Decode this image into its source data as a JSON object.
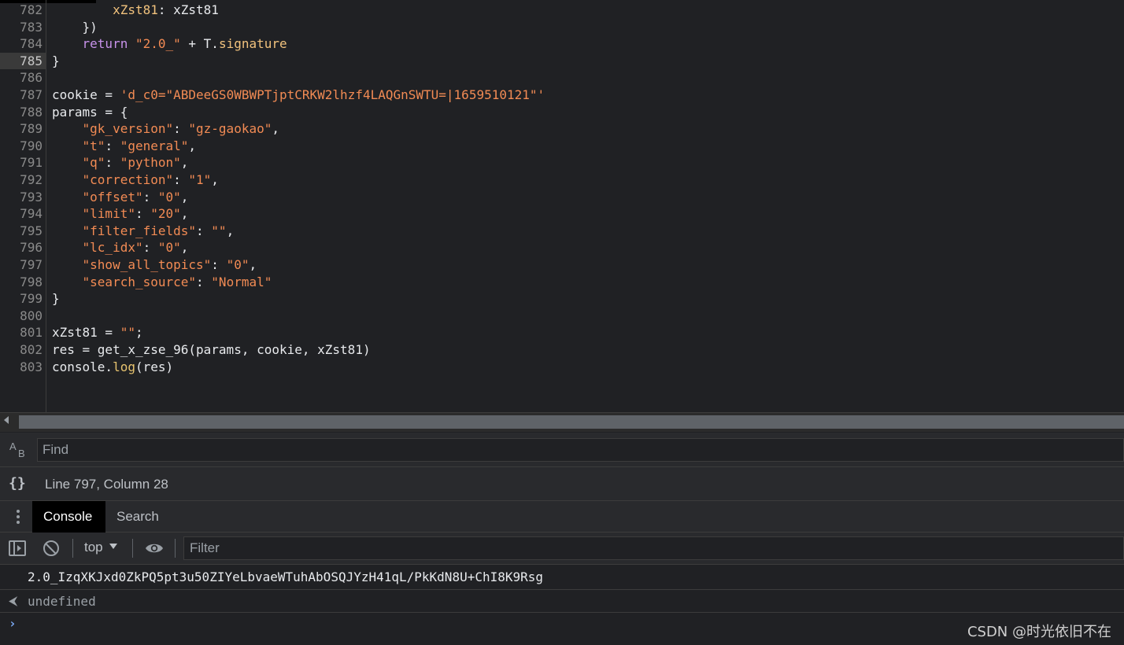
{
  "editor": {
    "active_line": 785,
    "lines": [
      {
        "n": "782",
        "tokens": [
          {
            "t": "        ",
            "c": "plain"
          },
          {
            "t": "xZst81",
            "c": "prop"
          },
          {
            "t": ": xZst81",
            "c": "plain"
          }
        ]
      },
      {
        "n": "783",
        "tokens": [
          {
            "t": "    })",
            "c": "plain"
          }
        ]
      },
      {
        "n": "784",
        "tokens": [
          {
            "t": "    ",
            "c": "plain"
          },
          {
            "t": "return",
            "c": "kw"
          },
          {
            "t": " ",
            "c": "plain"
          },
          {
            "t": "\"2.0_\"",
            "c": "str"
          },
          {
            "t": " + T.",
            "c": "plain"
          },
          {
            "t": "signature",
            "c": "prop"
          }
        ]
      },
      {
        "n": "785",
        "tokens": [
          {
            "t": "}",
            "c": "plain"
          }
        ]
      },
      {
        "n": "786",
        "tokens": []
      },
      {
        "n": "787",
        "tokens": [
          {
            "t": "cookie = ",
            "c": "plain"
          },
          {
            "t": "'d_c0=\"ABDeeGS0WBWPTjptCRKW2lhzf4LAQGnSWTU=|1659510121\"'",
            "c": "str"
          }
        ]
      },
      {
        "n": "788",
        "tokens": [
          {
            "t": "params = {",
            "c": "plain"
          }
        ]
      },
      {
        "n": "789",
        "tokens": [
          {
            "t": "    ",
            "c": "plain"
          },
          {
            "t": "\"gk_version\"",
            "c": "str"
          },
          {
            "t": ": ",
            "c": "plain"
          },
          {
            "t": "\"gz-gaokao\"",
            "c": "str"
          },
          {
            "t": ",",
            "c": "plain"
          }
        ]
      },
      {
        "n": "790",
        "tokens": [
          {
            "t": "    ",
            "c": "plain"
          },
          {
            "t": "\"t\"",
            "c": "str"
          },
          {
            "t": ": ",
            "c": "plain"
          },
          {
            "t": "\"general\"",
            "c": "str"
          },
          {
            "t": ",",
            "c": "plain"
          }
        ]
      },
      {
        "n": "791",
        "tokens": [
          {
            "t": "    ",
            "c": "plain"
          },
          {
            "t": "\"q\"",
            "c": "str"
          },
          {
            "t": ": ",
            "c": "plain"
          },
          {
            "t": "\"python\"",
            "c": "str"
          },
          {
            "t": ",",
            "c": "plain"
          }
        ]
      },
      {
        "n": "792",
        "tokens": [
          {
            "t": "    ",
            "c": "plain"
          },
          {
            "t": "\"correction\"",
            "c": "str"
          },
          {
            "t": ": ",
            "c": "plain"
          },
          {
            "t": "\"1\"",
            "c": "str"
          },
          {
            "t": ",",
            "c": "plain"
          }
        ]
      },
      {
        "n": "793",
        "tokens": [
          {
            "t": "    ",
            "c": "plain"
          },
          {
            "t": "\"offset\"",
            "c": "str"
          },
          {
            "t": ": ",
            "c": "plain"
          },
          {
            "t": "\"0\"",
            "c": "str"
          },
          {
            "t": ",",
            "c": "plain"
          }
        ]
      },
      {
        "n": "794",
        "tokens": [
          {
            "t": "    ",
            "c": "plain"
          },
          {
            "t": "\"limit\"",
            "c": "str"
          },
          {
            "t": ": ",
            "c": "plain"
          },
          {
            "t": "\"20\"",
            "c": "str"
          },
          {
            "t": ",",
            "c": "plain"
          }
        ]
      },
      {
        "n": "795",
        "tokens": [
          {
            "t": "    ",
            "c": "plain"
          },
          {
            "t": "\"filter_fields\"",
            "c": "str"
          },
          {
            "t": ": ",
            "c": "plain"
          },
          {
            "t": "\"\"",
            "c": "str"
          },
          {
            "t": ",",
            "c": "plain"
          }
        ]
      },
      {
        "n": "796",
        "tokens": [
          {
            "t": "    ",
            "c": "plain"
          },
          {
            "t": "\"lc_idx\"",
            "c": "str"
          },
          {
            "t": ": ",
            "c": "plain"
          },
          {
            "t": "\"0\"",
            "c": "str"
          },
          {
            "t": ",",
            "c": "plain"
          }
        ]
      },
      {
        "n": "797",
        "tokens": [
          {
            "t": "    ",
            "c": "plain"
          },
          {
            "t": "\"show_all_topics\"",
            "c": "str"
          },
          {
            "t": ": ",
            "c": "plain"
          },
          {
            "t": "\"0\"",
            "c": "str"
          },
          {
            "t": ",",
            "c": "plain"
          }
        ]
      },
      {
        "n": "798",
        "tokens": [
          {
            "t": "    ",
            "c": "plain"
          },
          {
            "t": "\"search_source\"",
            "c": "str"
          },
          {
            "t": ": ",
            "c": "plain"
          },
          {
            "t": "\"Normal\"",
            "c": "str"
          }
        ]
      },
      {
        "n": "799",
        "tokens": [
          {
            "t": "}",
            "c": "plain"
          }
        ]
      },
      {
        "n": "800",
        "tokens": []
      },
      {
        "n": "801",
        "tokens": [
          {
            "t": "xZst81 = ",
            "c": "plain"
          },
          {
            "t": "\"\"",
            "c": "str"
          },
          {
            "t": ";",
            "c": "plain"
          }
        ]
      },
      {
        "n": "802",
        "tokens": [
          {
            "t": "res = get_x_zse_96(params, cookie, xZst81)",
            "c": "plain"
          }
        ]
      },
      {
        "n": "803",
        "tokens": [
          {
            "t": "console.",
            "c": "plain"
          },
          {
            "t": "log",
            "c": "fn"
          },
          {
            "t": "(res)",
            "c": "plain"
          }
        ]
      }
    ]
  },
  "find": {
    "case_icon_a": "A",
    "case_icon_b": "B",
    "placeholder": "Find"
  },
  "status": {
    "icon": "{}",
    "position": "Line 797, Column 28"
  },
  "drawer": {
    "tabs": [
      {
        "label": "Console",
        "active": true
      },
      {
        "label": "Search",
        "active": false
      }
    ]
  },
  "console": {
    "context": "top",
    "filter_placeholder": "Filter",
    "output": "2.0_IzqXKJxd0ZkPQ5pt3u50ZIYeLbvaeWTuhAbOSQJYzH41qL/PkKdN8U+ChI8K9Rsg",
    "result_arrow": "⮜",
    "result": "undefined",
    "prompt": "›"
  },
  "watermark": "CSDN @时光依旧不在",
  "colors": {
    "background": "#202124",
    "keyword": "#c792ea",
    "string": "#f28b54",
    "property": "#f1c27d",
    "text": "#e8eaed",
    "prompt": "#7cacf8"
  }
}
